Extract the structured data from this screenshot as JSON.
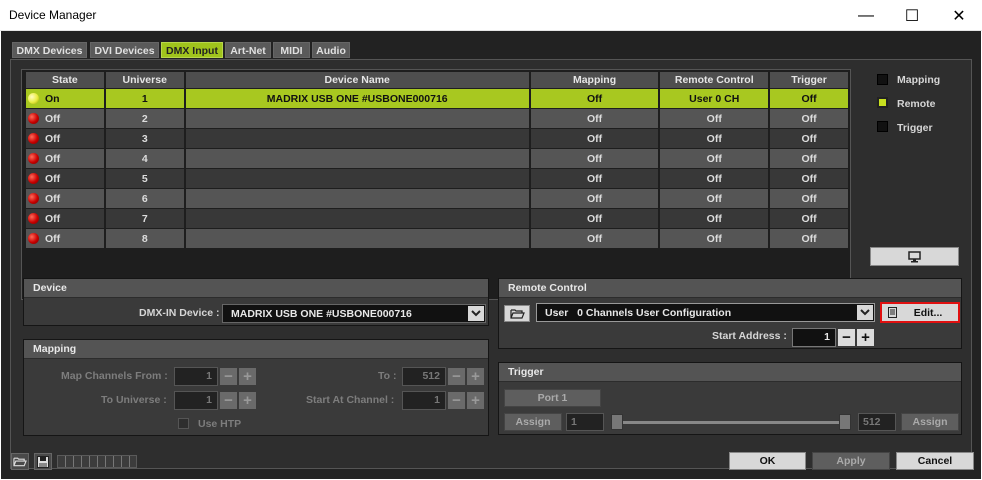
{
  "window": {
    "title": "Device Manager",
    "minimize": "—",
    "maximize": "☐",
    "close": "✕"
  },
  "tabs": [
    "DMX Devices",
    "DVI Devices",
    "DMX Input",
    "Art-Net",
    "MIDI",
    "Audio"
  ],
  "active_tab": "DMX Input",
  "table": {
    "headers": [
      "State",
      "Universe",
      "Device Name",
      "Mapping",
      "Remote Control",
      "Trigger"
    ],
    "rows": [
      {
        "state": "On",
        "universe": "1",
        "device": "MADRIX USB ONE #USBONE000716",
        "mapping": "Off",
        "remote": "User  0 CH",
        "trigger": "Off"
      },
      {
        "state": "Off",
        "universe": "2",
        "device": "",
        "mapping": "Off",
        "remote": "Off",
        "trigger": "Off"
      },
      {
        "state": "Off",
        "universe": "3",
        "device": "",
        "mapping": "Off",
        "remote": "Off",
        "trigger": "Off"
      },
      {
        "state": "Off",
        "universe": "4",
        "device": "",
        "mapping": "Off",
        "remote": "Off",
        "trigger": "Off"
      },
      {
        "state": "Off",
        "universe": "5",
        "device": "",
        "mapping": "Off",
        "remote": "Off",
        "trigger": "Off"
      },
      {
        "state": "Off",
        "universe": "6",
        "device": "",
        "mapping": "Off",
        "remote": "Off",
        "trigger": "Off"
      },
      {
        "state": "Off",
        "universe": "7",
        "device": "",
        "mapping": "Off",
        "remote": "Off",
        "trigger": "Off"
      },
      {
        "state": "Off",
        "universe": "8",
        "device": "",
        "mapping": "Off",
        "remote": "Off",
        "trigger": "Off"
      }
    ]
  },
  "filters": {
    "mapping": "Mapping",
    "remote": "Remote",
    "trigger": "Trigger"
  },
  "device_panel": {
    "title": "Device",
    "dmx_in_label": "DMX-IN Device :",
    "dmx_in_value": "MADRIX USB ONE #USBONE000716"
  },
  "mapping_panel": {
    "title": "Mapping",
    "from_label": "Map Channels From :",
    "from_value": "1",
    "to_label": "To :",
    "to_value": "512",
    "universe_label": "To Universe :",
    "universe_value": "1",
    "start_label": "Start At Channel :",
    "start_value": "1",
    "htp_label": "Use HTP"
  },
  "remote_panel": {
    "title": "Remote Control",
    "config_value": "User   0 Channels User Configuration",
    "edit_label": "Edit...",
    "start_label": "Start Address :",
    "start_value": "1"
  },
  "trigger_panel": {
    "title": "Trigger",
    "port_label": "Port 1",
    "assign_left": "Assign",
    "assign_right": "Assign",
    "range_from": "1",
    "range_to": "512"
  },
  "footer": {
    "ok": "OK",
    "apply": "Apply",
    "cancel": "Cancel"
  },
  "colors": {
    "accent": "#a8c820",
    "highlight_border": "#e01010",
    "led_off": "#c80000"
  }
}
